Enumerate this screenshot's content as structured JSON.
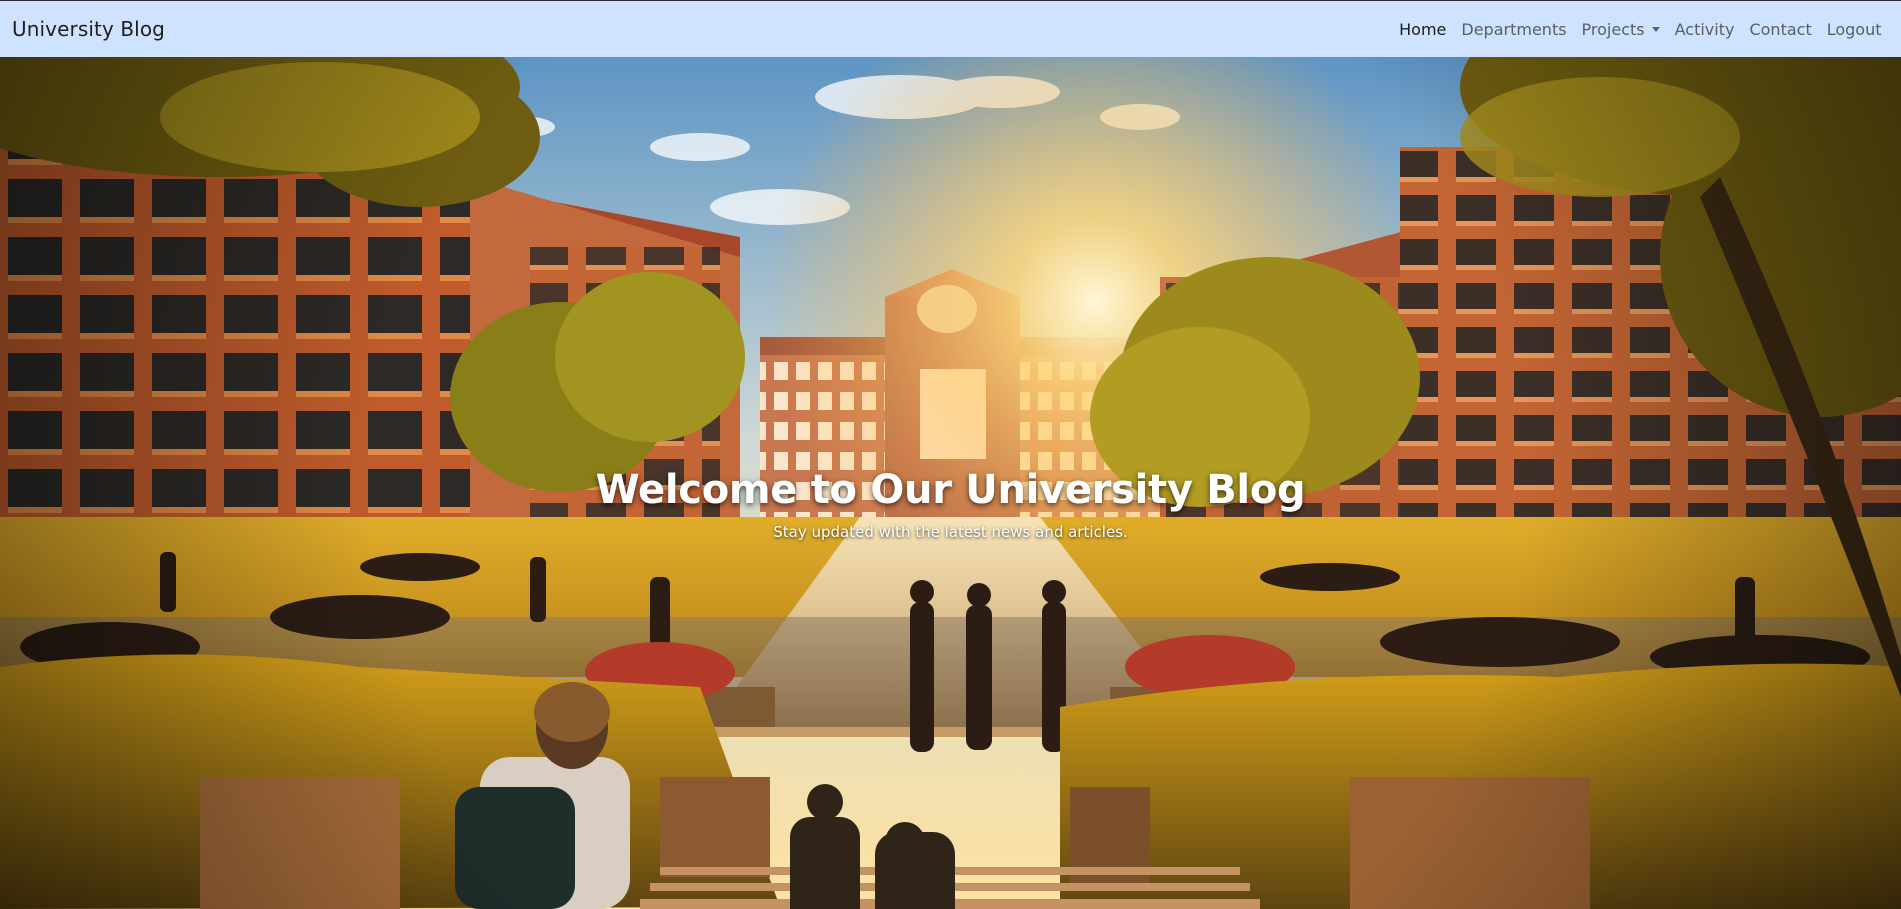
{
  "navbar": {
    "brand": "University Blog",
    "items": [
      {
        "label": "Home",
        "active": true
      },
      {
        "label": "Departments",
        "active": false
      },
      {
        "label": "Projects",
        "active": false,
        "dropdown": true
      },
      {
        "label": "Activity",
        "active": false
      },
      {
        "label": "Contact",
        "active": false
      },
      {
        "label": "Logout",
        "active": false
      }
    ]
  },
  "hero": {
    "title": "Welcome to Our University Blog",
    "subtitle": "Stay updated with the latest news and articles."
  },
  "colors": {
    "navbar_bg": "#cfe2ff",
    "sky_top": "#6ea3cf",
    "sun": "#ffe9a6",
    "brick": "#b5532a",
    "lawn": "#d6a421",
    "hedge": "#b08410"
  }
}
